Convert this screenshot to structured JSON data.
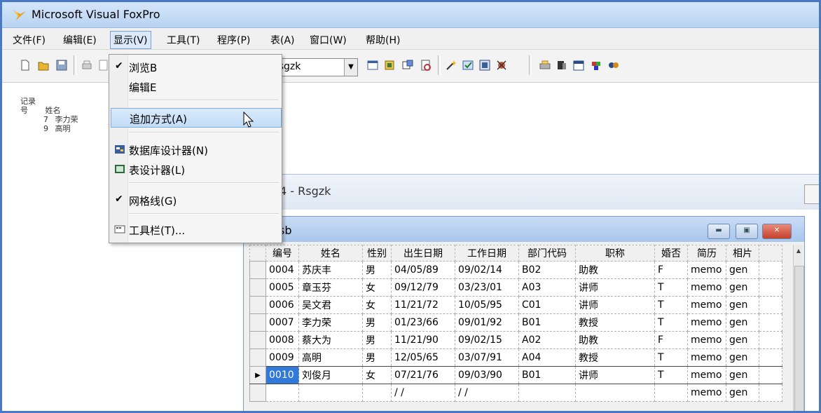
{
  "window": {
    "title": "Microsoft Visual FoxPro"
  },
  "menubar": {
    "items": [
      "文件(F)",
      "编辑(E)",
      "显示(V)",
      "工具(T)",
      "程序(P)",
      "表(A)",
      "窗口(W)",
      "帮助(H)"
    ]
  },
  "toolbar": {
    "combo_value": "rsgzk"
  },
  "background_list": {
    "headers": [
      "记录号",
      "姓名"
    ],
    "rows": [
      [
        "7",
        "李力荣"
      ],
      [
        "9",
        "高明"
      ]
    ]
  },
  "view_menu": {
    "items": [
      "浏览B",
      "编辑E",
      "追加方式(A)",
      "数据库设计器(N)",
      "表设计器(L)",
      "网格线(G)",
      "工具栏(T)..."
    ]
  },
  "browse": {
    "caption": "4 - Rsgzk",
    "window_title": "sb",
    "columns": [
      "编号",
      "姓名",
      "性别",
      "出生日期",
      "工作日期",
      "部门代码",
      "职称",
      "婚否",
      "简历",
      "相片"
    ],
    "rows": [
      [
        "0004",
        "苏庆丰",
        "男",
        "04/05/89",
        "09/02/14",
        "B02",
        "助教",
        "F",
        "memo",
        "gen"
      ],
      [
        "0005",
        "章玉芬",
        "女",
        "09/12/79",
        "03/23/01",
        "A03",
        "讲师",
        "T",
        "memo",
        "gen"
      ],
      [
        "0006",
        "吴文君",
        "女",
        "11/21/72",
        "10/05/95",
        "C01",
        "讲师",
        "T",
        "memo",
        "gen"
      ],
      [
        "0007",
        "李力荣",
        "男",
        "01/23/66",
        "09/01/92",
        "B01",
        "教授",
        "T",
        "memo",
        "gen"
      ],
      [
        "0008",
        "蔡大为",
        "男",
        "11/21/90",
        "09/02/15",
        "A02",
        "助教",
        "F",
        "memo",
        "gen"
      ],
      [
        "0009",
        "高明",
        "男",
        "12/05/65",
        "03/07/91",
        "A04",
        "教授",
        "T",
        "memo",
        "gen"
      ],
      [
        "0010",
        "刘俊月",
        "女",
        "07/21/76",
        "09/03/90",
        "B01",
        "讲师",
        "T",
        "memo",
        "gen"
      ],
      [
        "",
        "",
        "",
        "/ /",
        "/ /",
        "",
        "",
        "",
        "memo",
        "gen"
      ]
    ]
  },
  "colors": {
    "accent": "#3179d8",
    "frame": "#4a78c2",
    "close": "#c4402b"
  }
}
